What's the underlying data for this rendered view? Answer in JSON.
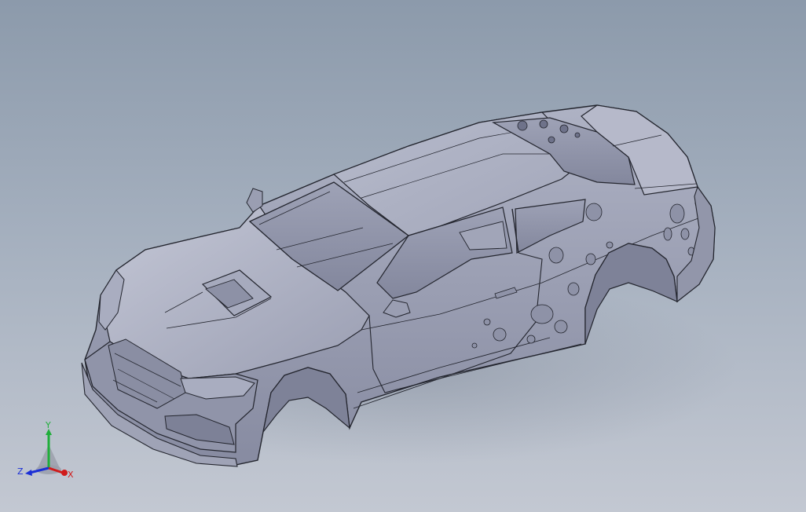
{
  "viewport": {
    "background_top": "#8c9aab",
    "background_bottom": "#c3c8d2",
    "model": {
      "fill_light": "#b4b8c8",
      "fill_mid": "#9da1b4",
      "fill_dark": "#7a7e94",
      "edge_color": "#23252e"
    }
  },
  "triad": {
    "y_label": "Y",
    "z_label": "Z",
    "x_label": "X",
    "y_color": "#1fae3a",
    "z_color": "#1b2fd6",
    "x_color": "#d01b1b"
  }
}
